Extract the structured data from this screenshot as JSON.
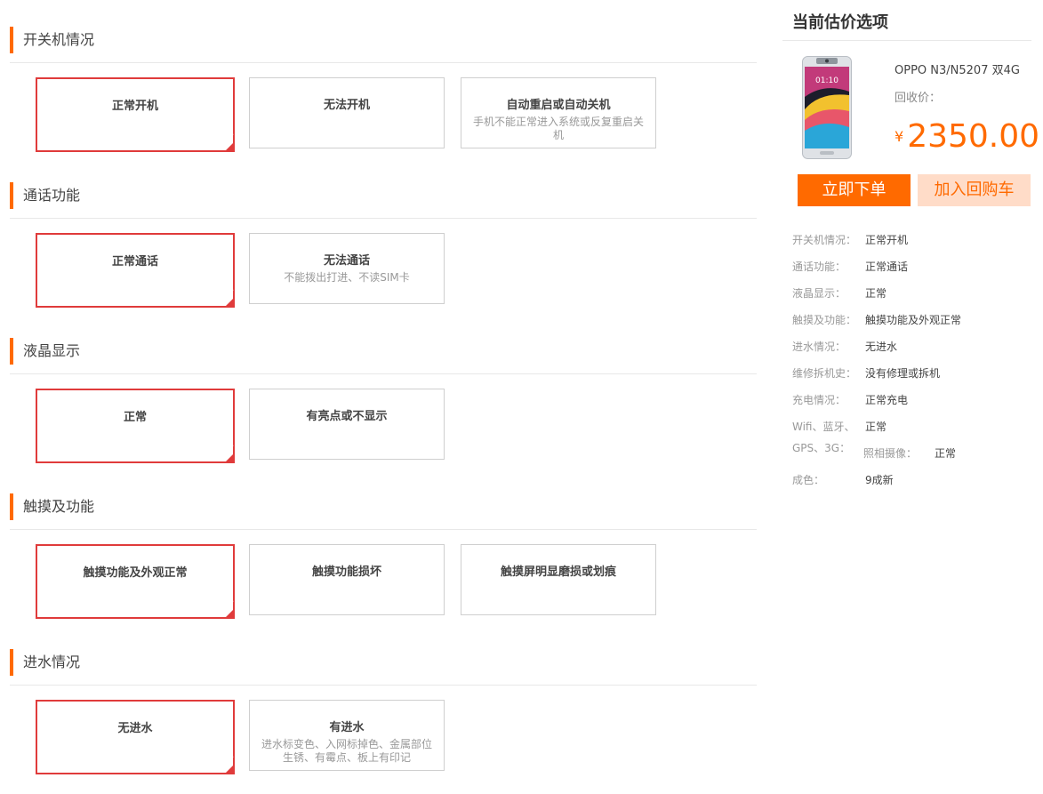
{
  "sections": [
    {
      "title": "开关机情况",
      "options": [
        {
          "label": "正常开机",
          "desc": "",
          "selected": true
        },
        {
          "label": "无法开机",
          "desc": "",
          "selected": false
        },
        {
          "label": "自动重启或自动关机",
          "desc": "手机不能正常进入系统或反复重启关机",
          "selected": false
        }
      ]
    },
    {
      "title": "通话功能",
      "options": [
        {
          "label": "正常通话",
          "desc": "",
          "selected": true
        },
        {
          "label": "无法通话",
          "desc": "不能拨出打进、不读SIM卡",
          "selected": false
        }
      ]
    },
    {
      "title": "液晶显示",
      "options": [
        {
          "label": "正常",
          "desc": "",
          "selected": true
        },
        {
          "label": "有亮点或不显示",
          "desc": "",
          "selected": false
        }
      ]
    },
    {
      "title": "触摸及功能",
      "options": [
        {
          "label": "触摸功能及外观正常",
          "desc": "",
          "selected": true
        },
        {
          "label": "触摸功能损坏",
          "desc": "",
          "selected": false
        },
        {
          "label": "触摸屏明显磨损或划痕",
          "desc": "",
          "selected": false
        }
      ]
    },
    {
      "title": "进水情况",
      "options": [
        {
          "label": "无进水",
          "desc": "",
          "selected": true
        },
        {
          "label": "有进水",
          "desc": "进水标变色、入网标掉色、金属部位生锈、有霉点、板上有印记",
          "selected": false
        }
      ]
    }
  ],
  "summary_panel": {
    "title": "当前估价选项",
    "phone_screen_time": "01:10",
    "model_name": "OPPO N3/N5207 双4G",
    "price_label": "回收价：",
    "currency_symbol": "¥",
    "price_value": "2350.00",
    "order_button": "立即下单",
    "cart_button": "加入回购车",
    "rows": [
      {
        "key": "开关机情况：",
        "value": "正常开机"
      },
      {
        "key": "通话功能：",
        "value": "正常通话"
      },
      {
        "key": "液晶显示：",
        "value": "正常"
      },
      {
        "key": "触摸及功能：",
        "value": "触摸功能及外观正常"
      },
      {
        "key": "进水情况：",
        "value": "无进水"
      },
      {
        "key": "维修拆机史：",
        "value": "没有修理或拆机"
      },
      {
        "key": "充电情况：",
        "value": "正常充电"
      }
    ],
    "wifi_key_line1": "Wifi、蓝牙、",
    "wifi_key_line2": "GPS、3G：",
    "wifi_value": "正常",
    "camera_key": "照相摄像：",
    "camera_value": "正常",
    "condition_key": "成色：",
    "condition_value": "9成新"
  },
  "colors": {
    "accent": "#ff6a00",
    "selected_border": "#e03b3b",
    "cart_bg": "#ffdcc8"
  }
}
